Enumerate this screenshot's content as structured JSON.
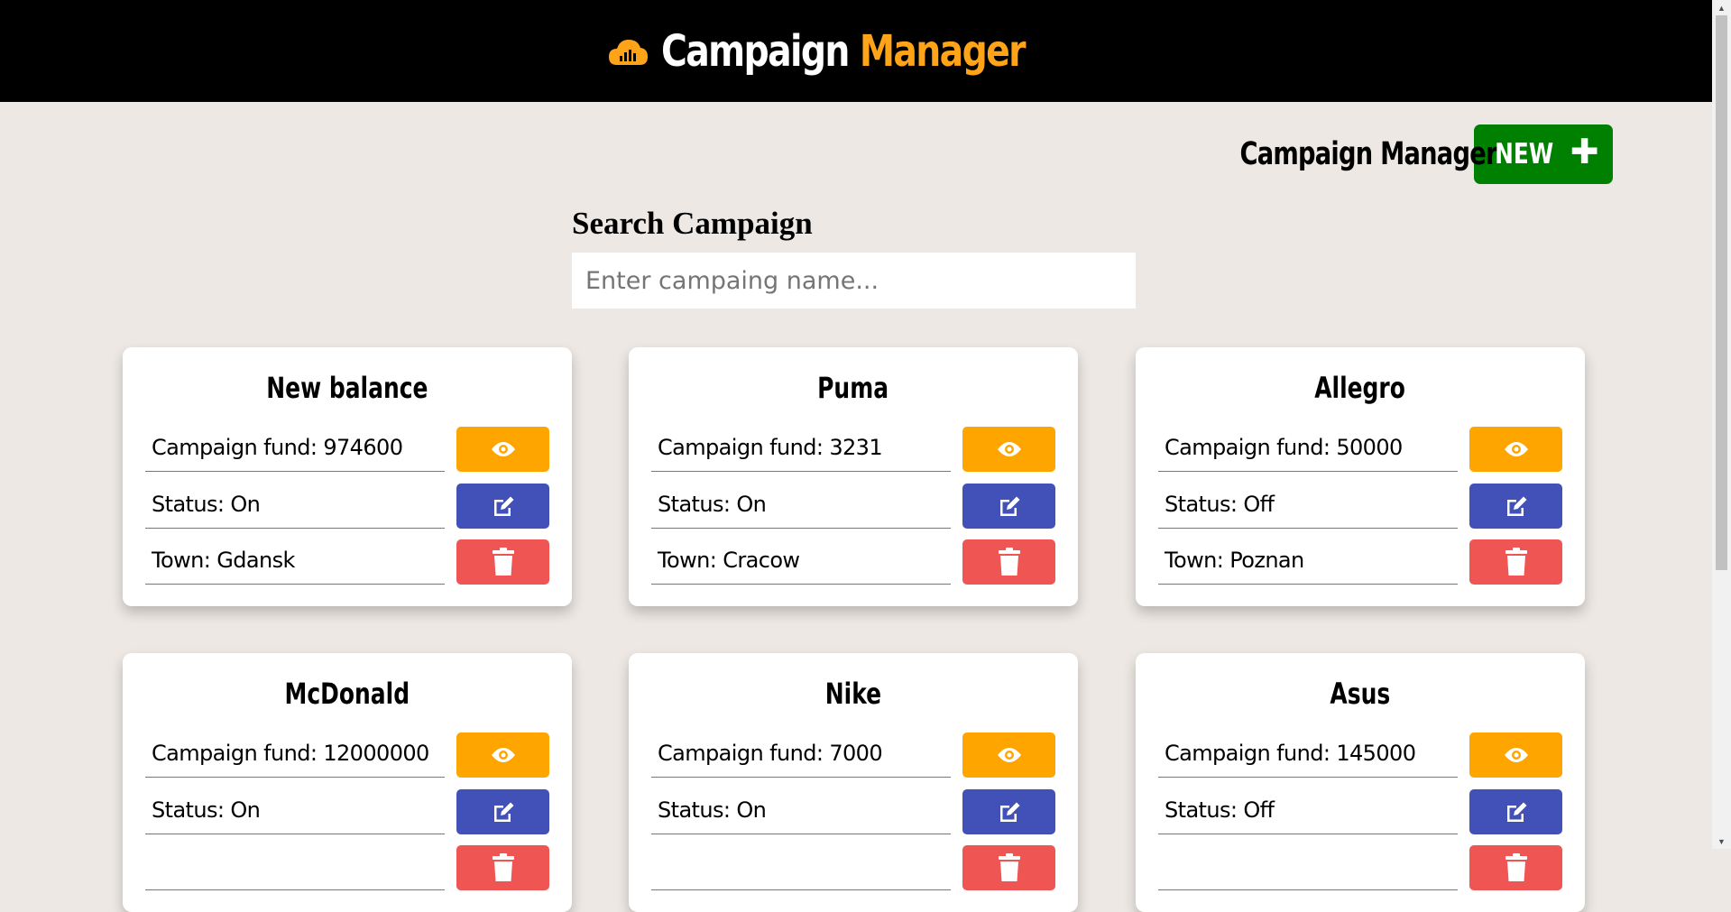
{
  "brand": {
    "icon": "cloud-chart-icon",
    "title_part1": "Campaign",
    "title_part2": "Manager",
    "colors": {
      "bar": "#000000",
      "accent": "#ffa319"
    }
  },
  "header": {
    "title": "Campaign Manager",
    "new_button": "NEW",
    "new_button_icon": "plus-icon",
    "new_button_color": "#008000"
  },
  "search": {
    "title": "Search Campaign",
    "placeholder": "Enter campaing name...",
    "value": ""
  },
  "actions": {
    "view_icon": "eye-icon",
    "view_color": "#ffa500",
    "edit_icon": "edit-icon",
    "edit_color": "#4151b8",
    "delete_icon": "trash-icon",
    "delete_color": "#ee5553"
  },
  "campaigns": [
    {
      "name": "New balance",
      "fund": "Campaign fund: 974600",
      "status": "Status: On",
      "town": "Town: Gdansk"
    },
    {
      "name": "Puma",
      "fund": "Campaign fund: 3231",
      "status": "Status: On",
      "town": "Town: Cracow"
    },
    {
      "name": "Allegro",
      "fund": "Campaign fund: 50000",
      "status": "Status: Off",
      "town": "Town: Poznan"
    },
    {
      "name": "McDonald",
      "fund": "Campaign fund: 12000000",
      "status": "Status: On",
      "town": ""
    },
    {
      "name": "Nike",
      "fund": "Campaign fund: 7000",
      "status": "Status: On",
      "town": ""
    },
    {
      "name": "Asus",
      "fund": "Campaign fund: 145000",
      "status": "Status: Off",
      "town": ""
    }
  ]
}
